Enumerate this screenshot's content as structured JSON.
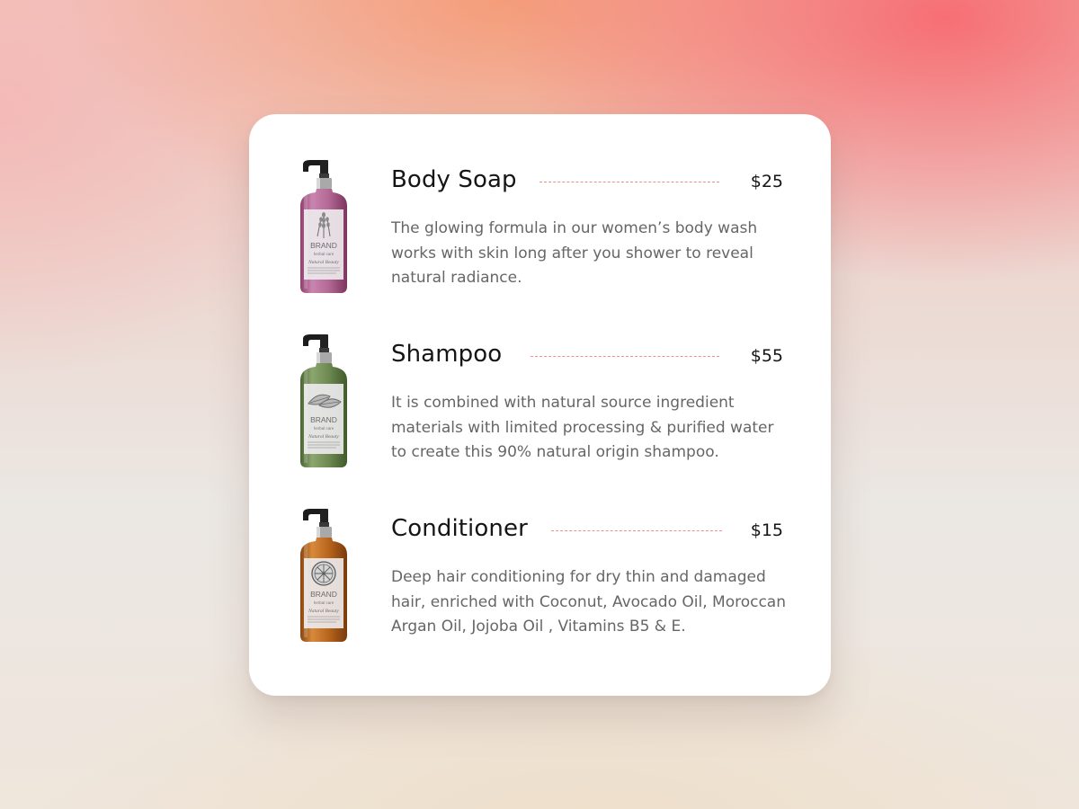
{
  "products": [
    {
      "name": "Body Soap",
      "price": "$25",
      "description": "The glowing formula in our women’s body wash works with skin long after you shower to reveal natural radiance.",
      "bottle_color": "#b46a94",
      "label_brand": "BRAND",
      "label_sub": "herbal care",
      "label_script": "Natural Beauty",
      "icon": "lavender-icon"
    },
    {
      "name": "Shampoo",
      "price": "$55",
      "description": "It is combined with natural source ingredient materials with limited processing & purified water to create this 90% natural origin shampoo.",
      "bottle_color": "#6e8a52",
      "label_brand": "BRAND",
      "label_sub": "herbal care",
      "label_script": "Natural Beauty",
      "icon": "leaf-icon"
    },
    {
      "name": "Conditioner",
      "price": "$15",
      "description": "Deep hair conditioning for dry thin and damaged hair, enriched with Coconut, Avocado Oil, Moroccan Argan Oil, Jojoba Oil , Vitamins B5 & E.",
      "bottle_color": "#b8661c",
      "label_brand": "BRAND",
      "label_sub": "herbal care",
      "label_script": "Natural Beauty",
      "icon": "citrus-slice-icon"
    }
  ],
  "colors": {
    "leader_dash": "#ee8f8a",
    "card": "#ffffff",
    "title": "#151515",
    "description": "#666666"
  }
}
